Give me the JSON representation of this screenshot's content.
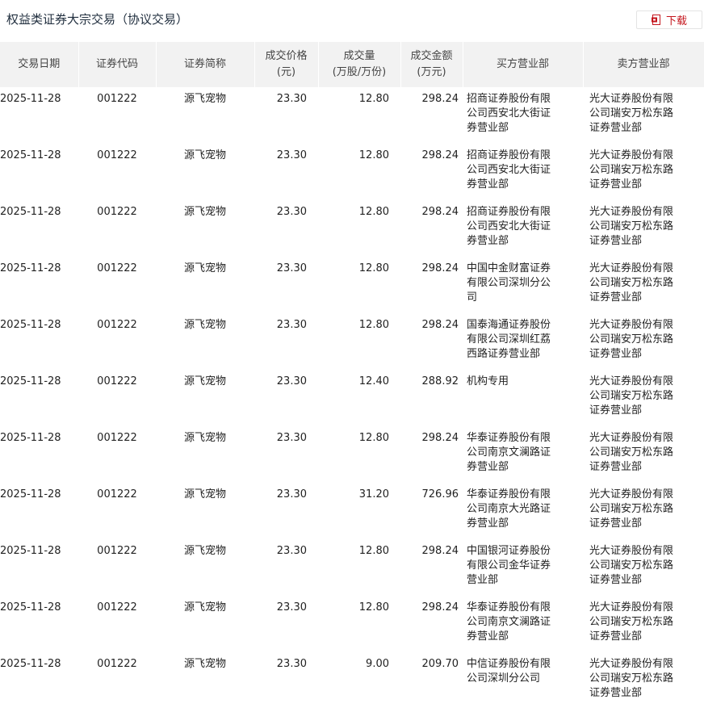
{
  "header": {
    "title": "权益类证券大宗交易（协议交易）",
    "download_label": "下载"
  },
  "table": {
    "columns": [
      "交易日期",
      "证券代码",
      "证券简称",
      "成交价格\n(元)",
      "成交量\n(万股/万份)",
      "成交金额\n(万元)",
      "买方营业部",
      "卖方营业部"
    ],
    "rows": [
      [
        "2025-11-28",
        "001222",
        "源飞宠物",
        "23.30",
        "12.80",
        "298.24",
        "招商证券股份有限公司西安北大街证券营业部",
        "光大证券股份有限公司瑞安万松东路证券营业部"
      ],
      [
        "2025-11-28",
        "001222",
        "源飞宠物",
        "23.30",
        "12.80",
        "298.24",
        "招商证券股份有限公司西安北大街证券营业部",
        "光大证券股份有限公司瑞安万松东路证券营业部"
      ],
      [
        "2025-11-28",
        "001222",
        "源飞宠物",
        "23.30",
        "12.80",
        "298.24",
        "招商证券股份有限公司西安北大街证券营业部",
        "光大证券股份有限公司瑞安万松东路证券营业部"
      ],
      [
        "2025-11-28",
        "001222",
        "源飞宠物",
        "23.30",
        "12.80",
        "298.24",
        "中国中金财富证券有限公司深圳分公司",
        "光大证券股份有限公司瑞安万松东路证券营业部"
      ],
      [
        "2025-11-28",
        "001222",
        "源飞宠物",
        "23.30",
        "12.80",
        "298.24",
        "国泰海通证券股份有限公司深圳红荔西路证券营业部",
        "光大证券股份有限公司瑞安万松东路证券营业部"
      ],
      [
        "2025-11-28",
        "001222",
        "源飞宠物",
        "23.30",
        "12.40",
        "288.92",
        "机构专用",
        "光大证券股份有限公司瑞安万松东路证券营业部"
      ],
      [
        "2025-11-28",
        "001222",
        "源飞宠物",
        "23.30",
        "12.80",
        "298.24",
        "华泰证券股份有限公司南京文澜路证券营业部",
        "光大证券股份有限公司瑞安万松东路证券营业部"
      ],
      [
        "2025-11-28",
        "001222",
        "源飞宠物",
        "23.30",
        "31.20",
        "726.96",
        "华泰证券股份有限公司南京大光路证券营业部",
        "光大证券股份有限公司瑞安万松东路证券营业部"
      ],
      [
        "2025-11-28",
        "001222",
        "源飞宠物",
        "23.30",
        "12.80",
        "298.24",
        "中国银河证券股份有限公司金华证券营业部",
        "光大证券股份有限公司瑞安万松东路证券营业部"
      ],
      [
        "2025-11-28",
        "001222",
        "源飞宠物",
        "23.30",
        "12.80",
        "298.24",
        "华泰证券股份有限公司南京文澜路证券营业部",
        "光大证券股份有限公司瑞安万松东路证券营业部"
      ],
      [
        "2025-11-28",
        "001222",
        "源飞宠物",
        "23.30",
        "9.00",
        "209.70",
        "中信证券股份有限公司深圳分公司",
        "光大证券股份有限公司瑞安万松东路证券营业部"
      ]
    ]
  },
  "icons": {
    "download": "document-download-icon"
  },
  "colors": {
    "accent": "#c4151c",
    "header_bg": "#f2f2f2",
    "title": "#1f2d3d"
  }
}
